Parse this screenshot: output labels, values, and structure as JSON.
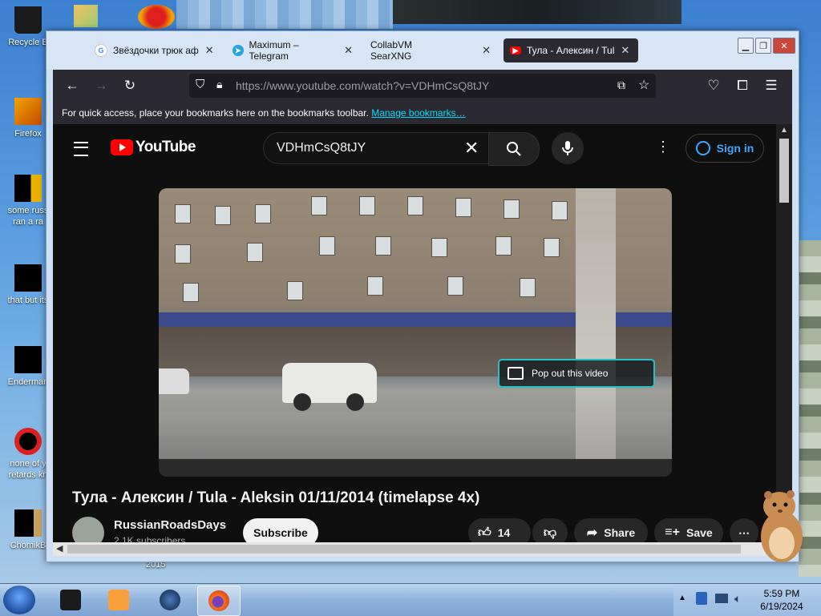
{
  "desktop": {
    "icons": [
      {
        "label": "Recycle B"
      },
      {
        "label": "Firefox"
      },
      {
        "label": "some russ ran a ra"
      },
      {
        "label": "that but its"
      },
      {
        "label": "Enderman"
      },
      {
        "label": "none of y retards kn"
      },
      {
        "label": "ChomikB"
      }
    ],
    "year_label": "2015"
  },
  "browser": {
    "tabs": [
      {
        "label": "Звёздочки трюк аф",
        "icon": "google-icon"
      },
      {
        "label": "Maximum – Telegram",
        "icon": "telegram-icon"
      },
      {
        "label": "CollabVM SearXNG",
        "icon": "none"
      },
      {
        "label": "Тула - Алексин / Tul",
        "icon": "youtube-icon",
        "active": true
      }
    ],
    "url": "https://www.youtube.com/watch?v=VDHmCsQ8tJY",
    "bookmarks_text": "For quick access, place your bookmarks here on the bookmarks toolbar.",
    "bookmarks_link": "Manage bookmarks…"
  },
  "youtube": {
    "logo_text": "YouTube",
    "search_value": "VDHmCsQ8tJY",
    "sign_in": "Sign in",
    "popout": "Pop out this video",
    "video_title": "Тула - Алексин / Tula - Aleksin 01/11/2014 (timelapse 4x)",
    "channel_name": "RussianRoadsDays",
    "channel_subs": "2.1K subscribers",
    "subscribe": "Subscribe",
    "likes": "14",
    "share": "Share",
    "save": "Save"
  },
  "taskbar": {
    "time": "5:59 PM",
    "date": "6/19/2024"
  },
  "colors": {
    "yt_red": "#ff0000",
    "link_blue": "#3ea6ff",
    "firefox_dark": "#2b2a33"
  }
}
